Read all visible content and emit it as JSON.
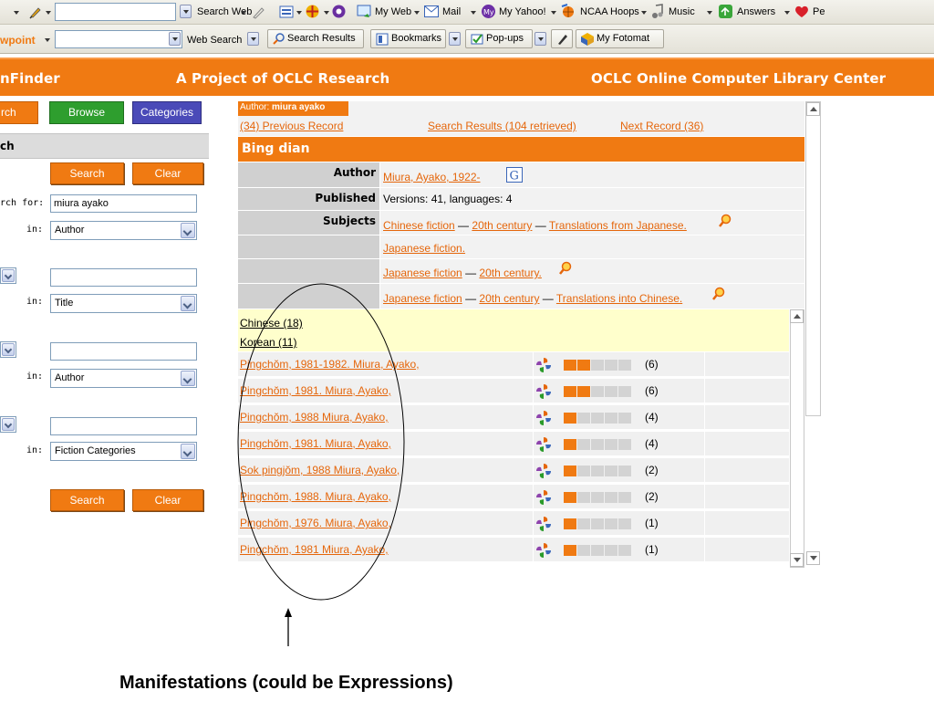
{
  "toolbar1": {
    "search_web_label": "Search Web",
    "my_web": "My Web",
    "mail": "Mail",
    "my_yahoo": "My Yahoo!",
    "ncaa_hoops": "NCAA Hoops",
    "music": "Music",
    "answers": "Answers",
    "partial_item": "Pe"
  },
  "toolbar2": {
    "partial_brand": "wpoint",
    "web_search": "Web Search",
    "search_results": "Search Results",
    "bookmarks": "Bookmarks",
    "popups": "Pop-ups",
    "my_fotomat": "My Fotomat"
  },
  "header": {
    "brand_partial": "nFinder",
    "project": "A Project of OCLC Research",
    "org": "OCLC Online Computer Library Center"
  },
  "left_panel": {
    "tab_search_partial": "rch",
    "tab_browse": "Browse",
    "tab_categories": "Categories",
    "section_title_partial": "ch",
    "search_button": "Search",
    "clear_button": "Clear",
    "search_for_label": "rch for:",
    "search_for_value": "miura ayako",
    "in_label": "in:",
    "field1_select": "Author",
    "field2_value": "",
    "field2_select": "Title",
    "field3_value": "",
    "field3_select": "Author",
    "field4_value": "",
    "field4_select": "Fiction Categories",
    "search_button_bottom": "Search",
    "clear_button_bottom": "Clear"
  },
  "record": {
    "crumb_prefix": "Author:",
    "crumb_value": "miura ayako",
    "prev_link": "(34) Previous Record",
    "results_link": "Search Results (104 retrieved)",
    "next_link": "Next Record (36)",
    "title": "Bing dian",
    "author_label": "Author",
    "author_value": "Miura, Ayako, 1922-",
    "published_label": "Published",
    "published_value": "Versions: 41, languages: 4",
    "subjects_label": "Subjects",
    "subjects": [
      {
        "parts": [
          "Chinese fiction",
          "20th century",
          "Translations from Japanese."
        ],
        "sep": " — "
      },
      {
        "parts": [
          "Japanese fiction."
        ],
        "sep": ""
      },
      {
        "parts": [
          "Japanese fiction",
          "20th century."
        ],
        "sep": " — "
      },
      {
        "parts": [
          "Japanese fiction",
          "20th century",
          "Translations into Chinese."
        ],
        "sep": " — "
      }
    ]
  },
  "languages": [
    {
      "label": "Chinese (18)"
    },
    {
      "label": "Korean (11)"
    }
  ],
  "editions": [
    {
      "title": "Pingchŏm, 1981-1982. Miura, Ayako,",
      "holdings": 2,
      "count": "(6)"
    },
    {
      "title": "Pingchŏm, 1981. Miura, Ayako,",
      "holdings": 2,
      "count": "(6)"
    },
    {
      "title": "Pingchŏm, 1988 Miura, Ayako,",
      "holdings": 1,
      "count": "(4)"
    },
    {
      "title": "Pingchŏm, 1981. Miura, Ayako,",
      "holdings": 1,
      "count": "(4)"
    },
    {
      "title": "Sok pingjŏm, 1988 Miura, Ayako,",
      "holdings": 1,
      "count": "(2)"
    },
    {
      "title": "Pingchŏm, 1988. Miura, Ayako,",
      "holdings": 1,
      "count": "(2)"
    },
    {
      "title": "Pingchŏm, 1976. Miura, Ayako,",
      "holdings": 1,
      "count": "(1)"
    },
    {
      "title": "Pingchŏm, 1981 Miura, Ayako,",
      "holdings": 1,
      "count": "(1)"
    }
  ],
  "annotation": {
    "caption": "Manifestations (could be Expressions)"
  },
  "colors": {
    "accent": "#f07a12",
    "link": "#e5660b",
    "highlight": "#ffffcc",
    "browse_tab": "#2e9e2e",
    "categories_tab": "#4a4ab8"
  }
}
